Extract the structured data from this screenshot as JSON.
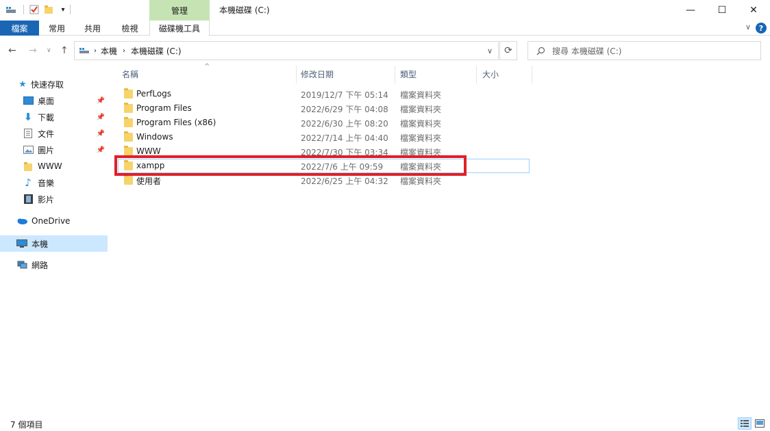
{
  "titlebar": {
    "manage_tab": "管理",
    "window_title": "本機磁碟 (C:)",
    "minimize": "—",
    "maximize": "☐",
    "close": "✕"
  },
  "ribbon": {
    "tabs": [
      "檔案",
      "常用",
      "共用",
      "檢視",
      "磁碟機工具"
    ],
    "help": "?"
  },
  "navigation": {
    "back": "←",
    "forward": "→",
    "up": "↑",
    "breadcrumb": [
      "本機",
      "本機磁碟 (C:)"
    ],
    "search_placeholder": "搜尋 本機磁碟 (C:)"
  },
  "sidebar": {
    "quick_access": "快速存取",
    "quick_items": [
      "桌面",
      "下載",
      "文件",
      "圖片",
      "WWW",
      "音樂",
      "影片"
    ],
    "onedrive": "OneDrive",
    "this_pc": "本機",
    "network": "網路"
  },
  "columns": {
    "name": "名稱",
    "date": "修改日期",
    "type": "類型",
    "size": "大小"
  },
  "files": [
    {
      "name": "PerfLogs",
      "date": "2019/12/7 下午 05:14",
      "type": "檔案資料夾"
    },
    {
      "name": "Program Files",
      "date": "2022/6/29 下午 04:08",
      "type": "檔案資料夾"
    },
    {
      "name": "Program Files (x86)",
      "date": "2022/6/30 上午 08:20",
      "type": "檔案資料夾"
    },
    {
      "name": "Windows",
      "date": "2022/7/14 上午 04:40",
      "type": "檔案資料夾"
    },
    {
      "name": "WWW",
      "date": "2022/7/30 下午 03:34",
      "type": "檔案資料夾"
    },
    {
      "name": "xampp",
      "date": "2022/7/6 上午 09:59",
      "type": "檔案資料夾"
    },
    {
      "name": "使用者",
      "date": "2022/6/25 上午 04:32",
      "type": "檔案資料夾"
    }
  ],
  "status": {
    "item_count": "7 個項目"
  },
  "colors": {
    "accent_blue": "#1a66b5",
    "manage_green": "#c6e3b3",
    "highlight_red": "#e21f26",
    "folder_yellow": "#f6d36b"
  }
}
